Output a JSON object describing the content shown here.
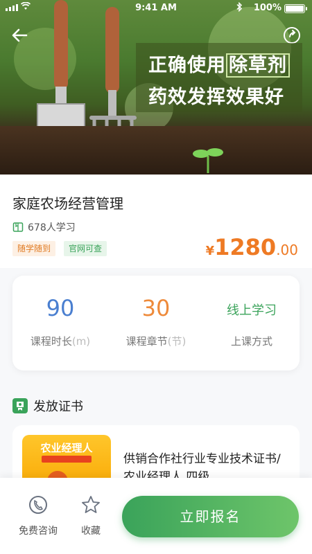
{
  "status_bar": {
    "time": "9:41 AM",
    "battery": "100%"
  },
  "hero": {
    "banner_line1_pre": "正确使用",
    "banner_line1_highlight": "除草剂",
    "banner_line2": "药效发挥效果好"
  },
  "course": {
    "title": "家庭农场经营管理",
    "learners": "678人学习",
    "tags": [
      "随学随到",
      "官网可查"
    ],
    "price_symbol": "¥",
    "price_integer": "1280",
    "price_decimal": ".00"
  },
  "stats": [
    {
      "value": "90",
      "label": "课程时长",
      "unit": "(m)",
      "color": "#4a7fd0"
    },
    {
      "value": "30",
      "label": "课程章节",
      "unit": "(节)",
      "color": "#ee8a3a"
    },
    {
      "value": "线上学习",
      "label": "上课方式",
      "unit": "",
      "color": "#3aa35a"
    }
  ],
  "certificate": {
    "section_title": "发放证书",
    "image_title": "农业经理人",
    "name": "供销合作社行业专业技术证书/农业经理人 四级"
  },
  "bottom_bar": {
    "consult_label": "免费咨询",
    "favorite_label": "收藏",
    "enroll_label": "立即报名"
  },
  "colors": {
    "accent_green": "#3aa35a",
    "price_orange": "#ee7a24"
  }
}
